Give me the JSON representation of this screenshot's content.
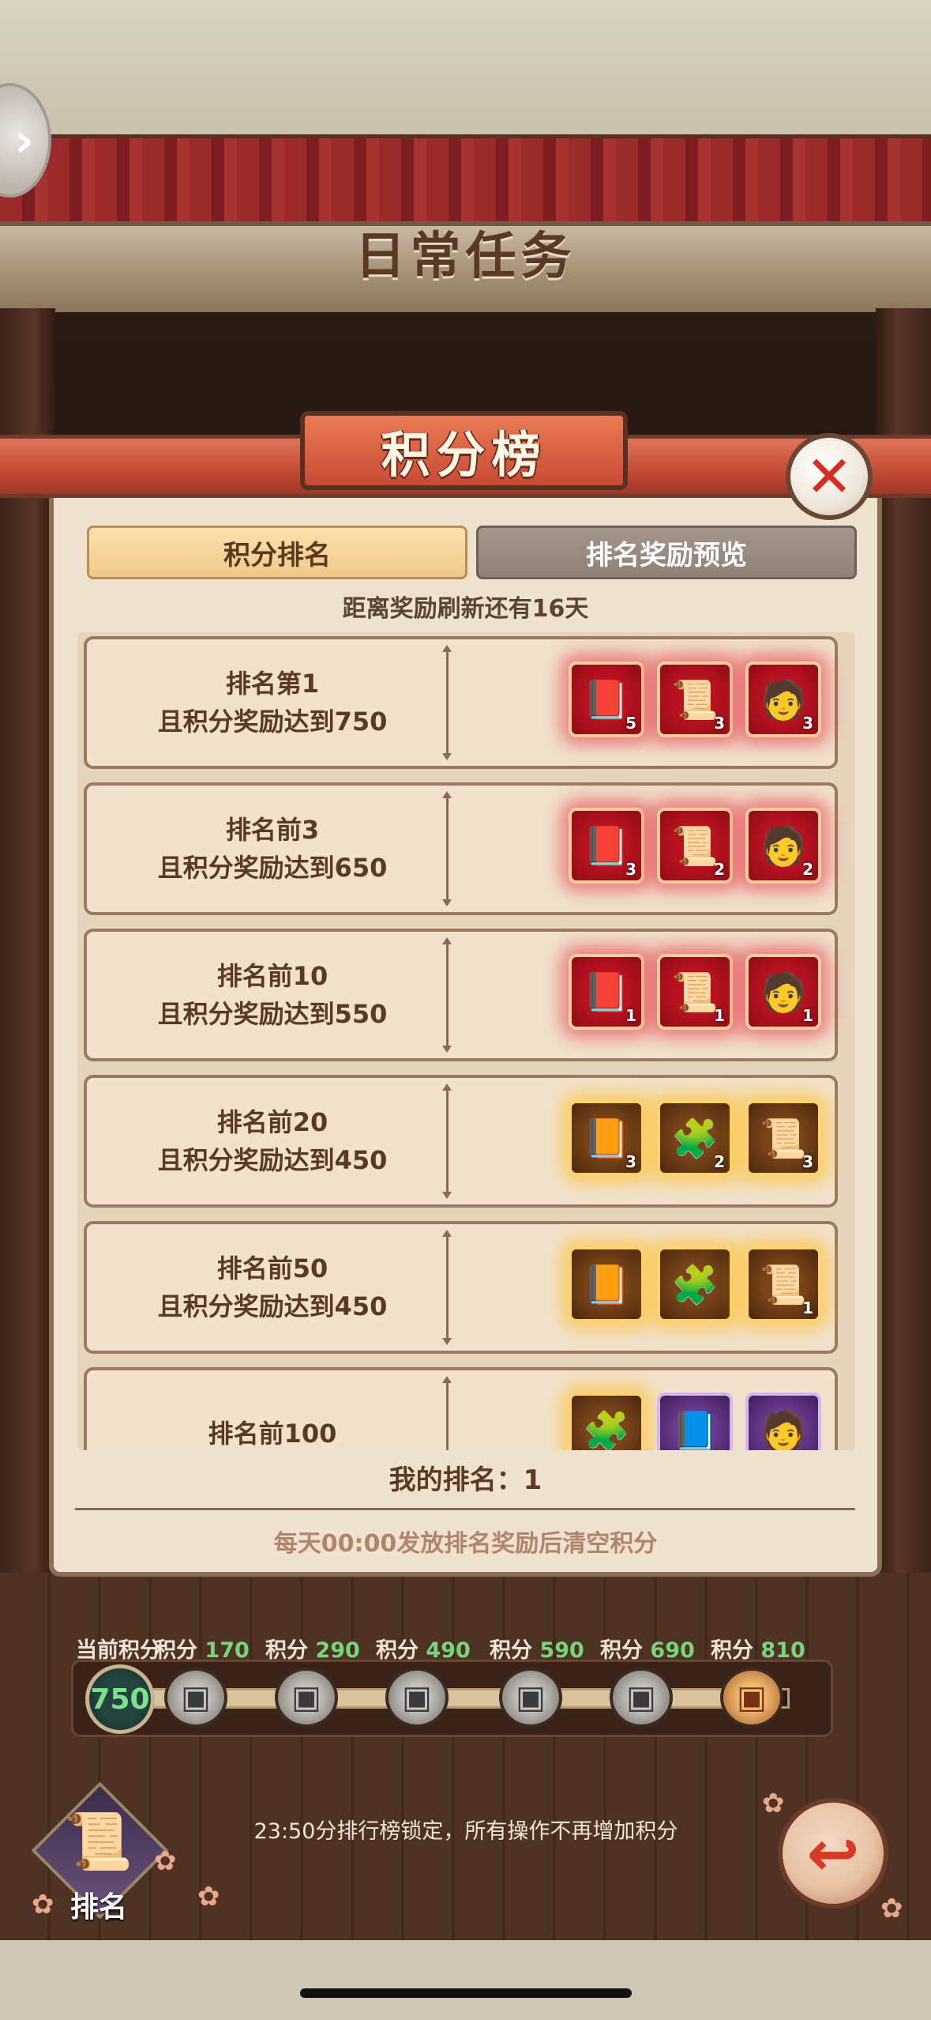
{
  "header": {
    "title": "日常任务"
  },
  "modal": {
    "title": "积分榜",
    "tabs": [
      {
        "label": "积分排名",
        "active": true
      },
      {
        "label": "排名奖励预览",
        "active": false
      }
    ],
    "refresh_text": "距离奖励刷新还有16天",
    "rows": [
      {
        "line1": "排名第1",
        "line2": "且积分奖励达到750",
        "items": [
          {
            "icon": "scroll-book-icon",
            "glyph": "📕",
            "count": "5",
            "rarity": "red"
          },
          {
            "icon": "map-scroll-icon",
            "glyph": "📜",
            "count": "3",
            "rarity": "red"
          },
          {
            "icon": "hero-portrait-icon",
            "glyph": "🧑",
            "count": "3",
            "rarity": "red"
          }
        ]
      },
      {
        "line1": "排名前3",
        "line2": "且积分奖励达到650",
        "items": [
          {
            "icon": "scroll-book-icon",
            "glyph": "📕",
            "count": "3",
            "rarity": "red"
          },
          {
            "icon": "map-scroll-icon",
            "glyph": "📜",
            "count": "2",
            "rarity": "red"
          },
          {
            "icon": "hero-portrait-icon",
            "glyph": "🧑",
            "count": "2",
            "rarity": "red"
          }
        ]
      },
      {
        "line1": "排名前10",
        "line2": "且积分奖励达到550",
        "items": [
          {
            "icon": "scroll-book-icon",
            "glyph": "📕",
            "count": "1",
            "rarity": "red"
          },
          {
            "icon": "map-scroll-icon",
            "glyph": "📜",
            "count": "1",
            "rarity": "red"
          },
          {
            "icon": "hero-portrait-icon",
            "glyph": "🧑",
            "count": "1",
            "rarity": "red"
          }
        ]
      },
      {
        "line1": "排名前20",
        "line2": "且积分奖励达到450",
        "items": [
          {
            "icon": "scroll-book-icon",
            "glyph": "📙",
            "count": "3",
            "rarity": "gold"
          },
          {
            "icon": "puzzle-piece-icon",
            "glyph": "🧩",
            "count": "2",
            "rarity": "gold"
          },
          {
            "icon": "map-scroll-icon",
            "glyph": "📜",
            "count": "3",
            "rarity": "gold"
          }
        ]
      },
      {
        "line1": "排名前50",
        "line2": "且积分奖励达到450",
        "items": [
          {
            "icon": "scroll-book-icon",
            "glyph": "📙",
            "count": "",
            "rarity": "gold"
          },
          {
            "icon": "puzzle-piece-icon",
            "glyph": "🧩",
            "count": "",
            "rarity": "gold"
          },
          {
            "icon": "map-scroll-icon",
            "glyph": "📜",
            "count": "1",
            "rarity": "gold"
          }
        ]
      },
      {
        "line1": "排名前100",
        "line2": "",
        "items": [
          {
            "icon": "puzzle-piece-icon",
            "glyph": "🧩",
            "count": "",
            "rarity": "gold"
          },
          {
            "icon": "scroll-book-icon",
            "glyph": "📘",
            "count": "",
            "rarity": "purple"
          },
          {
            "icon": "hero-portrait-icon",
            "glyph": "🧑",
            "count": "",
            "rarity": "purple"
          }
        ]
      }
    ],
    "my_rank": "我的排名：1",
    "clear_note": "每天00:00发放排名奖励后清空积分"
  },
  "progress": {
    "current_label": "当前积分",
    "current_value": "750",
    "milestones": [
      {
        "label": "积分",
        "value": "170"
      },
      {
        "label": "积分",
        "value": "290"
      },
      {
        "label": "积分",
        "value": "490"
      },
      {
        "label": "积分",
        "value": "590"
      },
      {
        "label": "积分",
        "value": "690"
      },
      {
        "label": "积分",
        "value": "810"
      }
    ]
  },
  "lock_note": "23:50分排行榜锁定，所有操作不再增加积分",
  "rank_button": {
    "label": "排名"
  }
}
